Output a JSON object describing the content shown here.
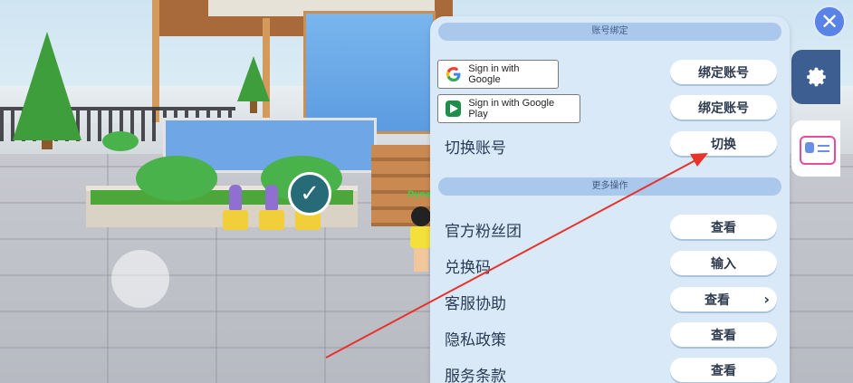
{
  "panel": {
    "section_account": "账号绑定",
    "google_signin": "Sign in with Google",
    "google_play_signin": "Sign in with Google Play",
    "bind_label_1": "绑定账号",
    "bind_label_2": "绑定账号",
    "switch_row": "切换账号",
    "switch_btn": "切换",
    "section_more": "更多操作",
    "rows": [
      {
        "label": "官方粉丝团",
        "button": "查看"
      },
      {
        "label": "兑换码",
        "button": "输入"
      },
      {
        "label": "客服协助",
        "button": "查看"
      },
      {
        "label": "隐私政策",
        "button": "查看"
      },
      {
        "label": "服务条款",
        "button": "查看"
      }
    ]
  },
  "scene": {
    "player_tag": "Dyna"
  },
  "icons": {
    "close": "close-icon",
    "settings": "gear-icon",
    "profile": "profile-card-icon",
    "joystick": "joystick",
    "check": "check-icon"
  },
  "colors": {
    "panel_bg": "#d9e9f8",
    "section_bar": "#a9c8ec",
    "settings_tab": "#3d5e90",
    "annotation": "#e8332a"
  }
}
